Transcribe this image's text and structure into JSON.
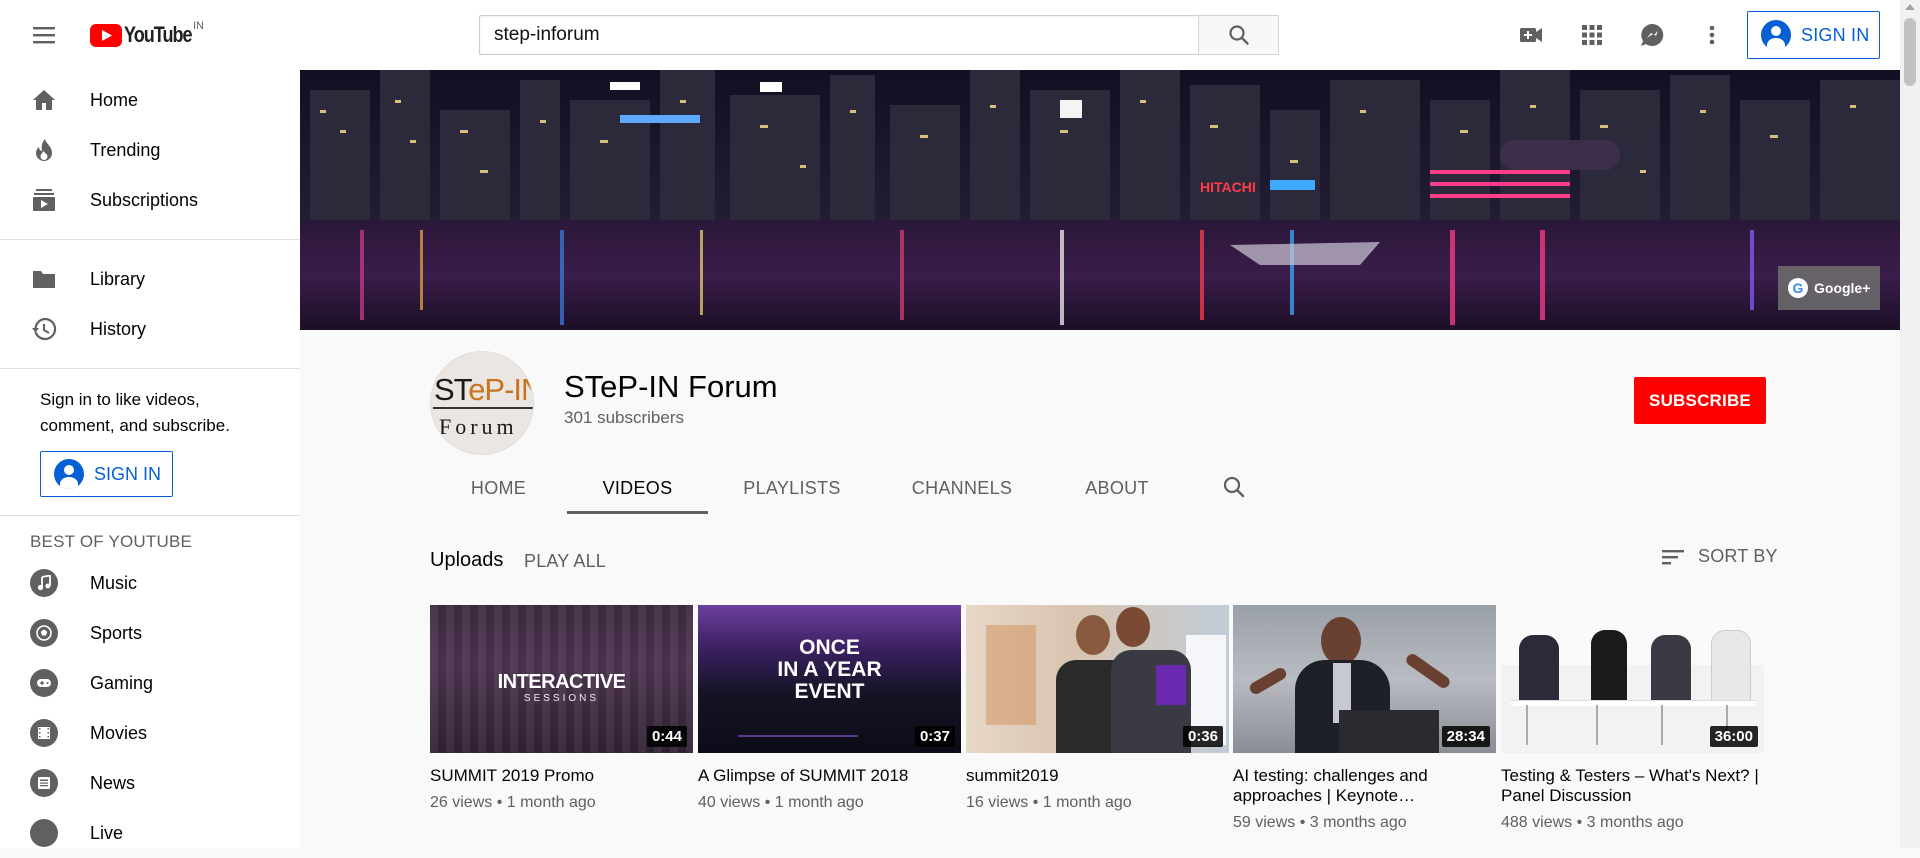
{
  "header": {
    "logo_text": "YouTube",
    "country_code": "IN",
    "search_value": "step-inforum",
    "sign_in_label": "SIGN IN",
    "icons": [
      "menu-icon",
      "search-icon",
      "create-video-icon",
      "apps-grid-icon",
      "messages-icon",
      "more-vert-icon",
      "account-icon"
    ]
  },
  "sidebar": {
    "main_items": [
      {
        "label": "Home",
        "icon": "home-icon"
      },
      {
        "label": "Trending",
        "icon": "trending-icon"
      },
      {
        "label": "Subscriptions",
        "icon": "subscriptions-icon"
      }
    ],
    "library_items": [
      {
        "label": "Library",
        "icon": "library-icon"
      },
      {
        "label": "History",
        "icon": "history-icon"
      }
    ],
    "signin_prompt": "Sign in to like videos, comment, and subscribe.",
    "signin_label": "SIGN IN",
    "best_heading": "BEST OF YOUTUBE",
    "best_items": [
      {
        "label": "Music",
        "icon": "music-icon"
      },
      {
        "label": "Sports",
        "icon": "sports-icon"
      },
      {
        "label": "Gaming",
        "icon": "gaming-icon"
      },
      {
        "label": "Movies",
        "icon": "movies-icon"
      },
      {
        "label": "News",
        "icon": "news-icon"
      },
      {
        "label": "Live",
        "icon": "live-icon"
      }
    ]
  },
  "banner": {
    "google_plus_label": "Google+",
    "signs": [
      "HITACHI"
    ]
  },
  "channel": {
    "avatar_line1_a": "ST",
    "avatar_line1_b": "eP-IN",
    "avatar_line2": "Forum",
    "name": "STeP-IN Forum",
    "subscribers": "301 subscribers",
    "subscribe_label": "SUBSCRIBE",
    "tabs": [
      "HOME",
      "VIDEOS",
      "PLAYLISTS",
      "CHANNELS",
      "ABOUT"
    ],
    "active_tab": "VIDEOS"
  },
  "uploads": {
    "title": "Uploads",
    "play_all": "PLAY ALL",
    "sort_by": "SORT BY",
    "videos": [
      {
        "title": "SUMMIT 2019 Promo",
        "duration": "0:44",
        "views": "26 views",
        "age": "1 month ago",
        "overlay_line1": "INTERACTIVE",
        "overlay_line2": "SESSIONS"
      },
      {
        "title": "A Glimpse of SUMMIT 2018",
        "duration": "0:37",
        "views": "40 views",
        "age": "1 month ago",
        "overlay_line1": "ONCE",
        "overlay_line2": "IN A YEAR",
        "overlay_line3": "EVENT"
      },
      {
        "title": "summit2019",
        "duration": "0:36",
        "views": "16 views",
        "age": "1 month ago"
      },
      {
        "title": "AI testing: challenges and approaches | Keynote…",
        "duration": "28:34",
        "views": "59 views",
        "age": "3 months ago"
      },
      {
        "title": "Testing & Testers – What's Next? | Panel Discussion",
        "duration": "36:00",
        "views": "488 views",
        "age": "3 months ago"
      }
    ]
  },
  "colors": {
    "brand_red": "#ff0000",
    "link_blue": "#065fd4",
    "text_secondary": "#606060"
  }
}
